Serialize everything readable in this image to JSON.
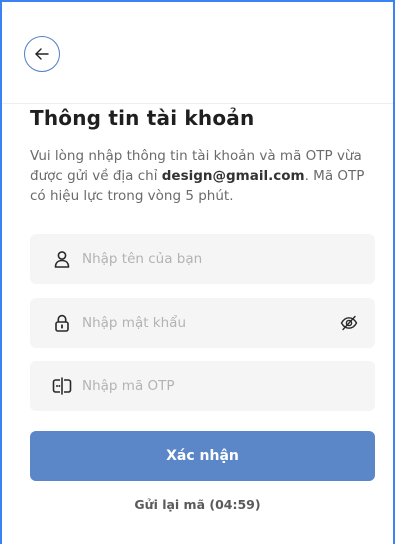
{
  "header": {
    "back_icon": "arrow-left-icon"
  },
  "title": "Thông tin tài khoản",
  "description": {
    "prefix": "Vui lòng nhập thông tin tài khoản và mã OTP vừa được gửi về địa chỉ ",
    "email": "design@gmail.com",
    "suffix": ". Mã OTP có hiệu lực trong vòng 5 phút."
  },
  "fields": {
    "name": {
      "placeholder": "Nhập tên của bạn",
      "icon": "user-icon"
    },
    "password": {
      "placeholder": "Nhập mật khẩu",
      "icon": "lock-icon",
      "toggle_icon": "eye-off-icon"
    },
    "otp": {
      "placeholder": "Nhập mã OTP",
      "icon": "otp-icon"
    }
  },
  "submit_label": "Xác nhận",
  "resend_label": "Gửi lại mã (04:59)",
  "colors": {
    "accent": "#5b87c9",
    "field_bg": "#f5f5f5",
    "frame": "#3b82f6"
  }
}
